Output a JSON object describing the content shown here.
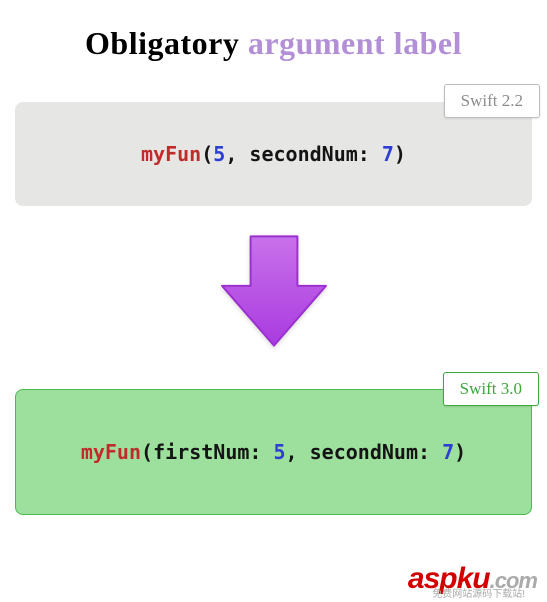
{
  "title": {
    "part1": "Obligatory ",
    "part2": "argument label"
  },
  "old": {
    "badge": "Swift 2.2",
    "code": {
      "func": "myFun",
      "open": "(",
      "arg1_value": "5",
      "sep": ", secondNum: ",
      "arg2_value": "7",
      "close": ")"
    }
  },
  "new": {
    "badge": "Swift 3.0",
    "code": {
      "func": "myFun",
      "open": "(firstNum: ",
      "arg1_value": "5",
      "sep": ", secondNum: ",
      "arg2_value": "7",
      "close": ")"
    }
  },
  "watermark": {
    "brand_main": "aspku",
    "brand_tld": ".com",
    "tagline": "免费网站源码下载站!"
  },
  "colors": {
    "purple": "#b847e6",
    "card_old_bg": "#e6e6e5",
    "card_new_bg": "#9de09d",
    "code_red": "#c12b2b",
    "code_blue": "#2d3ed4"
  }
}
